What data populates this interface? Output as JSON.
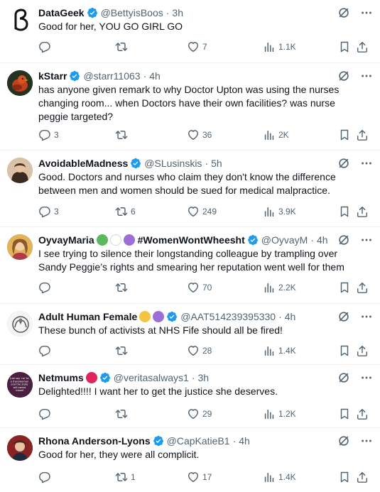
{
  "tweets": [
    {
      "name": "DataGeek",
      "handle": "@BettyisBoos",
      "time": "3h",
      "text": "Good for her, YOU GO GIRL GO",
      "replies": "",
      "retweets": "",
      "likes": "7",
      "views": "1.1K",
      "emoji": []
    },
    {
      "name": "kStarr",
      "handle": "@starr11063",
      "time": "4h",
      "text": "has anyone given remark to why Doctor Upton was using the nurses changing room... when Doctors have their own facilities?   was nurse peggie targeted?",
      "replies": "3",
      "retweets": "",
      "likes": "36",
      "views": "2K",
      "emoji": []
    },
    {
      "name": "AvoidableMadness",
      "handle": "@SLusinskis",
      "time": "5h",
      "text": "Good. Doctors and nurses who claim they don't know the difference between men and women should be sued for medical malpractice.",
      "replies": "3",
      "retweets": "6",
      "likes": "249",
      "views": "3.9K",
      "emoji": []
    },
    {
      "name": "OyvayMaria",
      "name_suffix": "#WomenWontWheesht",
      "handle": "@OyvayM",
      "time": "4h",
      "text": "I see trying to silence their longstanding colleague by trampling over Sandy Peggie’s rights and smearing her reputation went well for them",
      "replies": "",
      "retweets": "",
      "likes": "70",
      "views": "2.2K",
      "emoji": [
        "green-heart",
        "white-heart",
        "purple-heart"
      ]
    },
    {
      "name": "Adult Human Female",
      "handle": "@AAT514239395330",
      "time": "4h",
      "text": "These bunch of activists at NHS Fife should all be fired!",
      "replies": "",
      "retweets": "",
      "likes": "28",
      "views": "1.4K",
      "emoji": [
        "person-shrugging",
        "purple-heart"
      ]
    },
    {
      "name": "Netmums",
      "handle": "@veritasalways1",
      "time": "3h",
      "text": "Delighted!!!! I want her to get the justice she deserves.",
      "replies": "",
      "retweets": "",
      "likes": "29",
      "views": "1.2K",
      "emoji": [
        "hearts-emoji"
      ]
    },
    {
      "name": "Rhona Anderson-Lyons",
      "handle": "@CapKatieB1",
      "time": "4h",
      "text": "Good for her, they were all complicit.",
      "replies": "",
      "retweets": "1",
      "likes": "17",
      "views": "1.4K",
      "emoji": []
    }
  ],
  "avatar_texts": {
    "netmums": "Just say 'no' to a transwoman and the state will sweat blood!"
  },
  "colors": {
    "verified": "#1d9bf0",
    "muted": "#536471",
    "text": "#0f1419",
    "divider": "#eff3f4"
  },
  "icons": {
    "header": [
      "grok-icon",
      "more-icon"
    ],
    "actions": [
      "reply-icon",
      "retweet-icon",
      "like-icon",
      "views-icon",
      "bookmark-icon",
      "share-icon"
    ]
  }
}
